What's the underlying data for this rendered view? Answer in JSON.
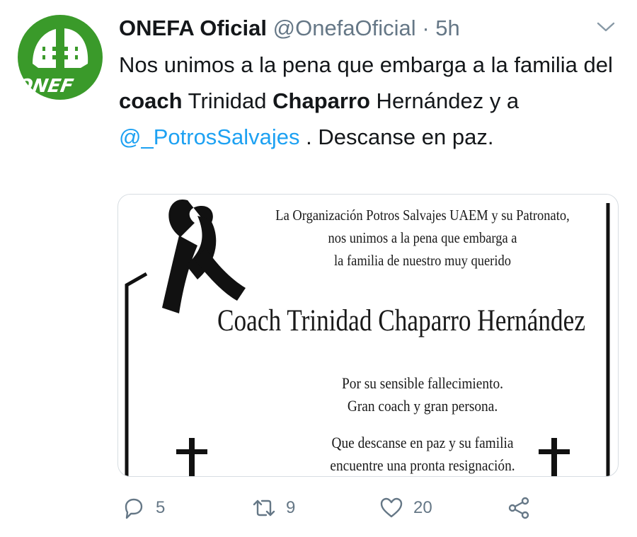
{
  "tweet": {
    "author_name": "ONEFA Oficial",
    "author_handle": "@OnefaOficial",
    "separator": "·",
    "time": "5h",
    "text_part1": "Nos unimos a la pena que embarga a la familia del ",
    "bold1": "coach",
    "text_part2": " Trinidad ",
    "bold2": "Chaparro",
    "text_part3": " Hernández y a ",
    "mention": "@_PotrosSalvajes",
    "text_part4": " . Descanse en paz.",
    "avatar_logo_text": "ONEF"
  },
  "card": {
    "line1": "La Organización Potros Salvajes UAEM y su Patronato,",
    "line2": "nos unimos a la pena que embarga a",
    "line3": "la familia de nuestro muy querido",
    "name": "Coach Trinidad Chaparro Hernández",
    "para1": "Por su sensible fallecimiento.",
    "para2": "Gran coach y gran persona.",
    "para3": "Que descanse en paz y su familia",
    "para4": "encuentre una pronta resignación."
  },
  "actions": {
    "reply_count": "5",
    "retweet_count": "9",
    "like_count": "20"
  },
  "colors": {
    "accent": "#1da1f2",
    "secondary_text": "#657786",
    "logo_green": "#3a9a2a"
  }
}
